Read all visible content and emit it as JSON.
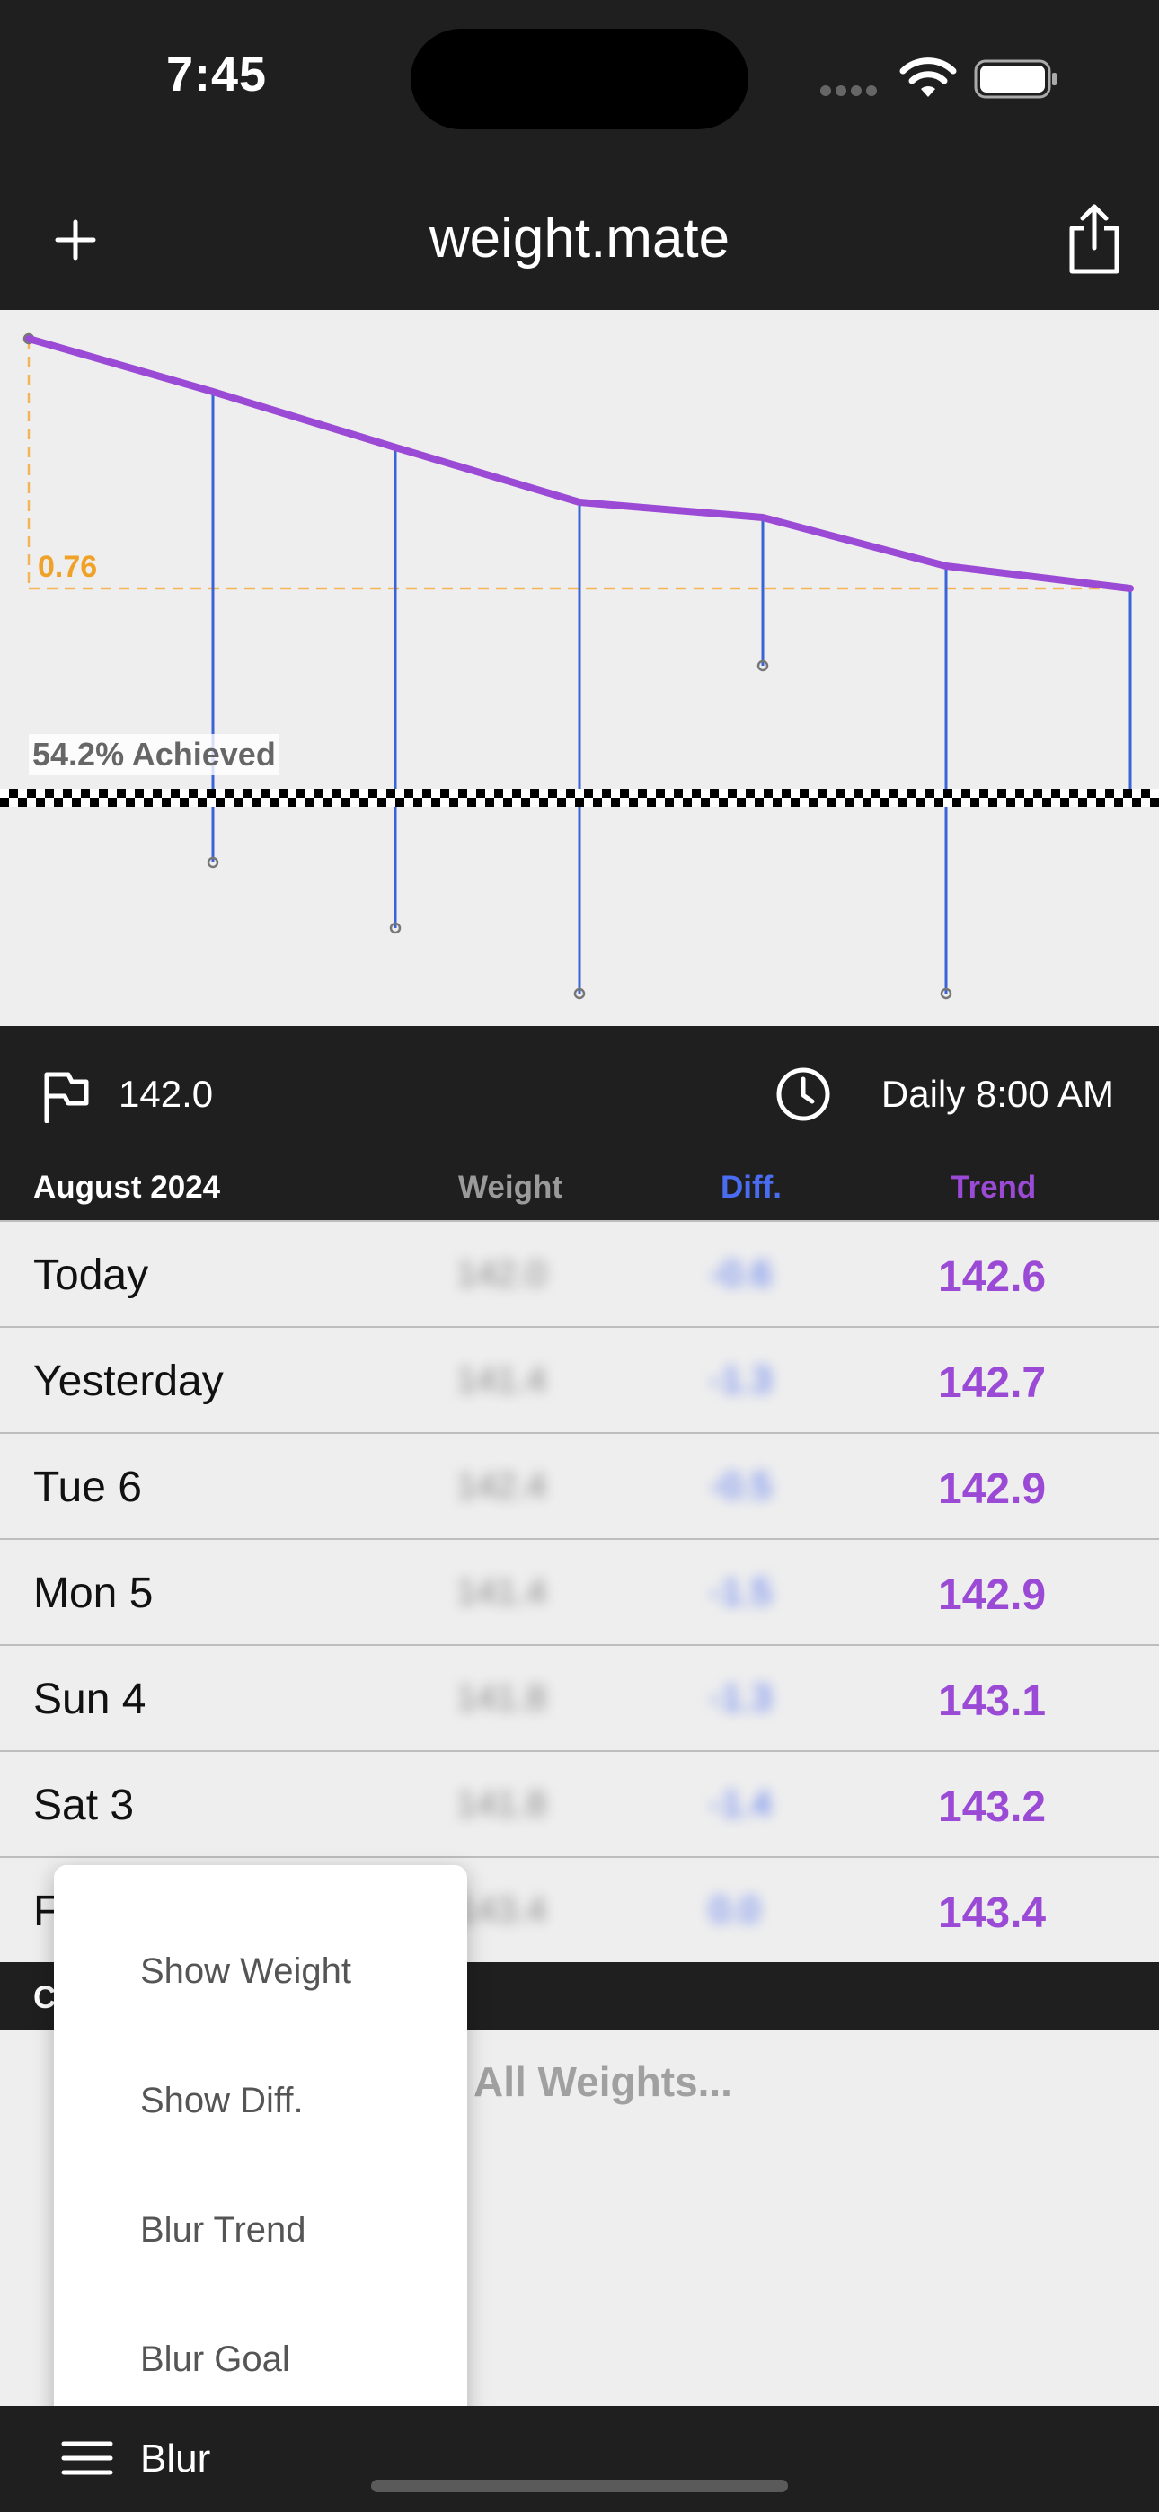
{
  "status": {
    "time": "7:45"
  },
  "nav": {
    "title": "weight.mate"
  },
  "chart_data": {
    "type": "line",
    "goal_gap_label": "0.76",
    "achieved_label": "54.2% Achieved",
    "trend": [
      143.5,
      143.4,
      143.2,
      143.1,
      142.9,
      142.9,
      142.7,
      142.6
    ],
    "series_colors": {
      "trend": "#9b4ad6",
      "diff": "#3a63d8",
      "goal": "#f0a127"
    }
  },
  "info": {
    "goal": "142.0",
    "reminder": "Daily 8:00 AM"
  },
  "table": {
    "month": "August 2024",
    "col_weight": "Weight",
    "col_diff": "Diff.",
    "col_trend": "Trend",
    "rows": [
      {
        "day": "Today",
        "weight": "142.0",
        "diff": "-0.6",
        "trend": "142.6"
      },
      {
        "day": "Yesterday",
        "weight": "141.4",
        "diff": "-1.3",
        "trend": "142.7"
      },
      {
        "day": "Tue 6",
        "weight": "142.4",
        "diff": "-0.5",
        "trend": "142.9"
      },
      {
        "day": "Mon 5",
        "weight": "141.4",
        "diff": "-1.5",
        "trend": "142.9"
      },
      {
        "day": "Sun 4",
        "weight": "141.8",
        "diff": "-1.3",
        "trend": "143.1"
      },
      {
        "day": "Sat 3",
        "weight": "141.8",
        "diff": "-1.4",
        "trend": "143.2"
      },
      {
        "day": "Fri 2",
        "weight": "143.4",
        "diff": "0.0",
        "trend": "143.4"
      }
    ],
    "section_label": "C",
    "all_weights": "All Weights..."
  },
  "menu": {
    "items": [
      "Show Weight",
      "Show Diff.",
      "Blur Trend",
      "Blur Goal"
    ]
  },
  "toolbar": {
    "blur_label": "Blur"
  },
  "colors": {
    "background": "#1f1f1f",
    "panel": "#eeeeee",
    "accent_trend": "#9b4ad6",
    "accent_diff": "#4a6cf0"
  }
}
